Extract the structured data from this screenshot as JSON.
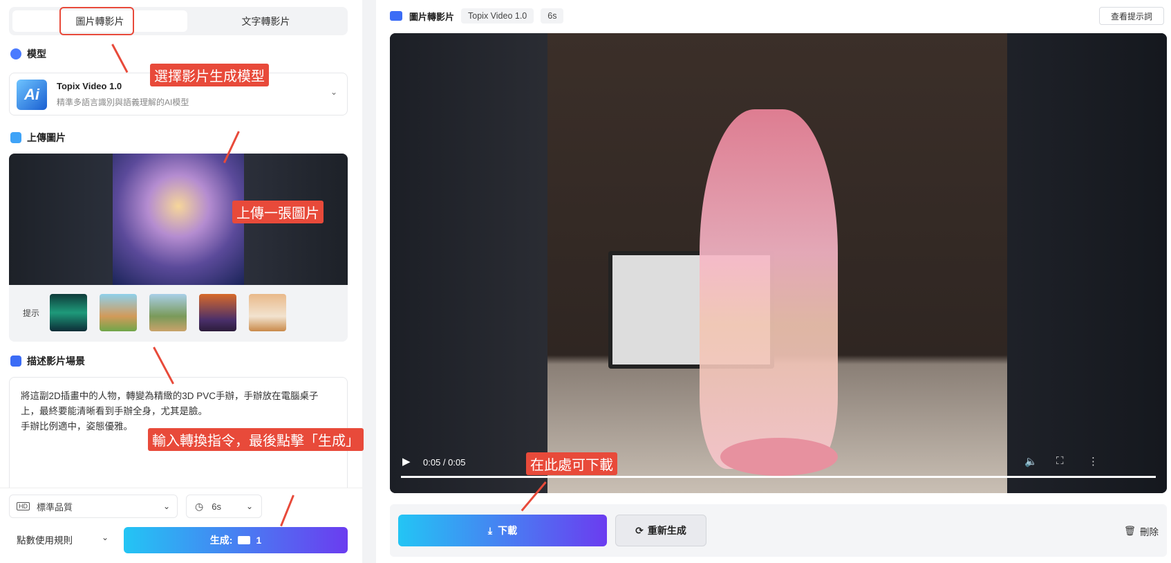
{
  "tabs": {
    "image_to_video": "圖片轉影片",
    "text_to_video": "文字轉影片"
  },
  "model_section": {
    "title": "模型",
    "name": "Topix Video 1.0",
    "desc": "精準多語言識別與語義理解的AI模型",
    "logo": "Ai"
  },
  "upload_section": {
    "title": "上傳圖片",
    "hint_label": "提示"
  },
  "prompt_section": {
    "title": "描述影片場景",
    "text": "將這副2D插畫中的人物，轉變為精緻的3D PVC手辦，手辦放在電腦桌子上，最終要能清晰看到手辦全身，尤其是臉。\n手辦比例適中，姿態優雅。"
  },
  "bottom": {
    "quality_icon": "HD",
    "quality": "標準品質",
    "duration": "6s",
    "rules": "點數使用規則",
    "generate_label": "生成:",
    "generate_cost": "1"
  },
  "annotations": {
    "a1": "選擇影片生成模型",
    "a2": "上傳一張圖片",
    "a3": "輸入轉換指令，最後點擊「生成」",
    "a4": "在此處可下載"
  },
  "right_header": {
    "title": "圖片轉影片",
    "model": "Topix Video 1.0",
    "duration": "6s",
    "view_prompt": "查看提示詞"
  },
  "video": {
    "time": "0:05 / 0:05"
  },
  "actions": {
    "download": "下載",
    "regenerate": "重新生成",
    "delete": "刪除"
  }
}
